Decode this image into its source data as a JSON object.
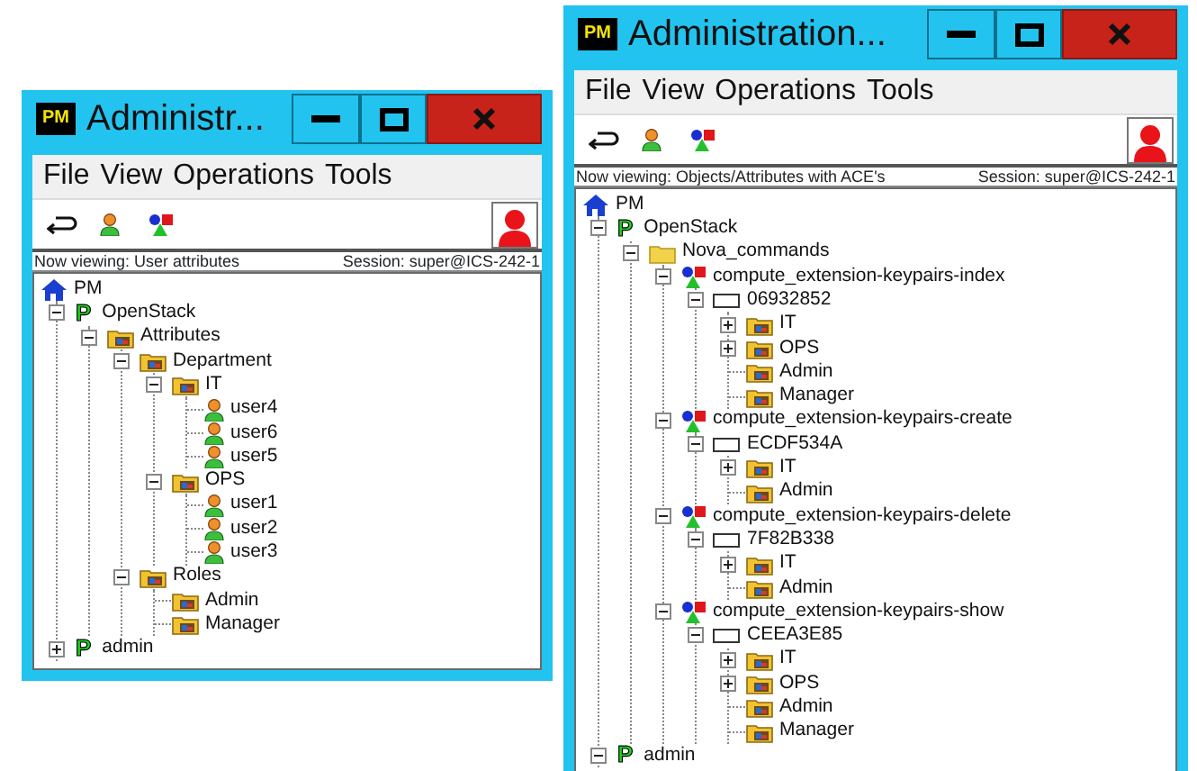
{
  "windows": [
    {
      "title": "Administr...",
      "logo": "PM",
      "menu": [
        "File",
        "View",
        "Operations",
        "Tools"
      ],
      "status": {
        "viewing": "Now viewing: User attributes",
        "session": "Session: super@ICS-242-1"
      },
      "tree": {
        "label": "PM",
        "kind": "home",
        "children": [
          {
            "label": "OpenStack",
            "kind": "policy",
            "mark": "P",
            "expanded": true,
            "children": [
              {
                "label": "Attributes",
                "kind": "attribute",
                "expanded": true,
                "children": [
                  {
                    "label": "Department",
                    "kind": "attribute",
                    "expanded": true,
                    "children": [
                      {
                        "label": "IT",
                        "kind": "attribute",
                        "expanded": true,
                        "children": [
                          {
                            "label": "user4",
                            "kind": "user"
                          },
                          {
                            "label": "user6",
                            "kind": "user"
                          },
                          {
                            "label": "user5",
                            "kind": "user"
                          }
                        ]
                      },
                      {
                        "label": "OPS",
                        "kind": "attribute",
                        "expanded": true,
                        "children": [
                          {
                            "label": "user1",
                            "kind": "user"
                          },
                          {
                            "label": "user2",
                            "kind": "user"
                          },
                          {
                            "label": "user3",
                            "kind": "user"
                          }
                        ]
                      }
                    ]
                  },
                  {
                    "label": "Roles",
                    "kind": "attribute",
                    "expanded": true,
                    "children": [
                      {
                        "label": "Admin",
                        "kind": "attribute"
                      },
                      {
                        "label": "Manager",
                        "kind": "attribute"
                      }
                    ]
                  }
                ]
              }
            ]
          },
          {
            "label": "admin",
            "kind": "policy",
            "mark": "P",
            "expanded": false
          }
        ]
      }
    },
    {
      "title": "Administration...",
      "logo": "PM",
      "menu": [
        "File",
        "View",
        "Operations",
        "Tools"
      ],
      "status": {
        "viewing": "Now viewing: Objects/Attributes with ACE's",
        "session": "Session: super@ICS-242-1"
      },
      "tree": {
        "label": "PM",
        "kind": "home",
        "children": [
          {
            "label": "OpenStack",
            "kind": "policy",
            "mark": "P",
            "expanded": true,
            "children": [
              {
                "label": "Nova_commands",
                "kind": "folder",
                "expanded": true,
                "children": [
                  {
                    "label": "compute_extension-keypairs-index",
                    "kind": "object",
                    "expanded": true,
                    "children": [
                      {
                        "label": "06932852",
                        "kind": "item",
                        "expanded": true,
                        "children": [
                          {
                            "label": "IT",
                            "kind": "attribute",
                            "expanded": false
                          },
                          {
                            "label": "OPS",
                            "kind": "attribute",
                            "expanded": false
                          },
                          {
                            "label": "Admin",
                            "kind": "attribute"
                          },
                          {
                            "label": "Manager",
                            "kind": "attribute"
                          }
                        ]
                      }
                    ]
                  },
                  {
                    "label": "compute_extension-keypairs-create",
                    "kind": "object",
                    "expanded": true,
                    "children": [
                      {
                        "label": "ECDF534A",
                        "kind": "item",
                        "expanded": true,
                        "children": [
                          {
                            "label": "IT",
                            "kind": "attribute",
                            "expanded": false
                          },
                          {
                            "label": "Admin",
                            "kind": "attribute"
                          }
                        ]
                      }
                    ]
                  },
                  {
                    "label": "compute_extension-keypairs-delete",
                    "kind": "object",
                    "expanded": true,
                    "children": [
                      {
                        "label": "7F82B338",
                        "kind": "item",
                        "expanded": true,
                        "children": [
                          {
                            "label": "IT",
                            "kind": "attribute",
                            "expanded": false
                          },
                          {
                            "label": "Admin",
                            "kind": "attribute"
                          }
                        ]
                      }
                    ]
                  },
                  {
                    "label": "compute_extension-keypairs-show",
                    "kind": "object",
                    "expanded": true,
                    "children": [
                      {
                        "label": "CEEA3E85",
                        "kind": "item",
                        "expanded": true,
                        "children": [
                          {
                            "label": "IT",
                            "kind": "attribute",
                            "expanded": false
                          },
                          {
                            "label": "OPS",
                            "kind": "attribute",
                            "expanded": false
                          },
                          {
                            "label": "Admin",
                            "kind": "attribute"
                          },
                          {
                            "label": "Manager",
                            "kind": "attribute"
                          }
                        ]
                      }
                    ]
                  }
                ]
              }
            ]
          },
          {
            "label": "admin",
            "kind": "policy",
            "mark": "P",
            "expanded": true
          }
        ]
      }
    }
  ]
}
